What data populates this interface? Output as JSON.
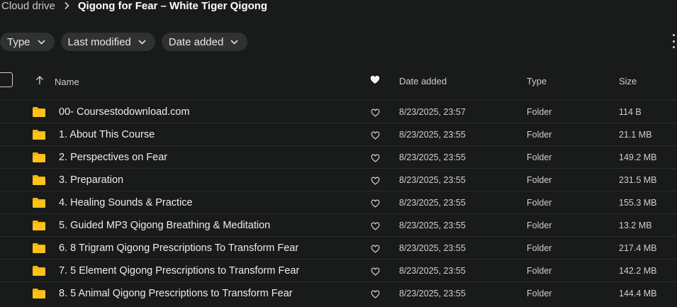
{
  "breadcrumb": {
    "root": "Cloud drive",
    "current": "Qigong for Fear – White Tiger Qigong"
  },
  "filters": [
    {
      "label": "Type"
    },
    {
      "label": "Last modified"
    },
    {
      "label": "Date added"
    }
  ],
  "table": {
    "headers": {
      "name": "Name",
      "date_added": "Date added",
      "type": "Type",
      "size": "Size"
    },
    "rows": [
      {
        "name": "00- Coursestodownload.com",
        "date_added": "8/23/2025, 23:57",
        "type": "Folder",
        "size": "114 B"
      },
      {
        "name": "1. About This Course",
        "date_added": "8/23/2025, 23:55",
        "type": "Folder",
        "size": "21.1 MB"
      },
      {
        "name": "2. Perspectives on Fear",
        "date_added": "8/23/2025, 23:55",
        "type": "Folder",
        "size": "149.2 MB"
      },
      {
        "name": "3. Preparation",
        "date_added": "8/23/2025, 23:55",
        "type": "Folder",
        "size": "231.5 MB"
      },
      {
        "name": "4. Healing Sounds & Practice",
        "date_added": "8/23/2025, 23:55",
        "type": "Folder",
        "size": "155.3 MB"
      },
      {
        "name": "5. Guided MP3 Qigong Breathing & Meditation",
        "date_added": "8/23/2025, 23:55",
        "type": "Folder",
        "size": "13.2 MB"
      },
      {
        "name": "6. 8 Trigram Qigong Prescriptions To Transform Fear",
        "date_added": "8/23/2025, 23:55",
        "type": "Folder",
        "size": "217.4 MB"
      },
      {
        "name": "7. 5 Element Qigong Prescriptions to Transform Fear",
        "date_added": "8/23/2025, 23:55",
        "type": "Folder",
        "size": "142.2 MB"
      },
      {
        "name": "8. 5 Animal Qigong Prescriptions to Transform Fear",
        "date_added": "8/23/2025, 23:55",
        "type": "Folder",
        "size": "144.4 MB"
      }
    ]
  },
  "colors": {
    "background": "#191a1a",
    "chip": "#2f3132",
    "folder": "#f4b400",
    "row_divider": "#2a2b2c"
  },
  "icons": {
    "breadcrumb_separator": "chevron-right-icon",
    "chip_dropdown": "chevron-down-icon",
    "sort": "arrow-up-icon",
    "favourite_header": "heart-filled-icon",
    "favourite_row": "heart-outline-icon",
    "folder": "folder-icon",
    "more": "more-vertical-icon"
  }
}
